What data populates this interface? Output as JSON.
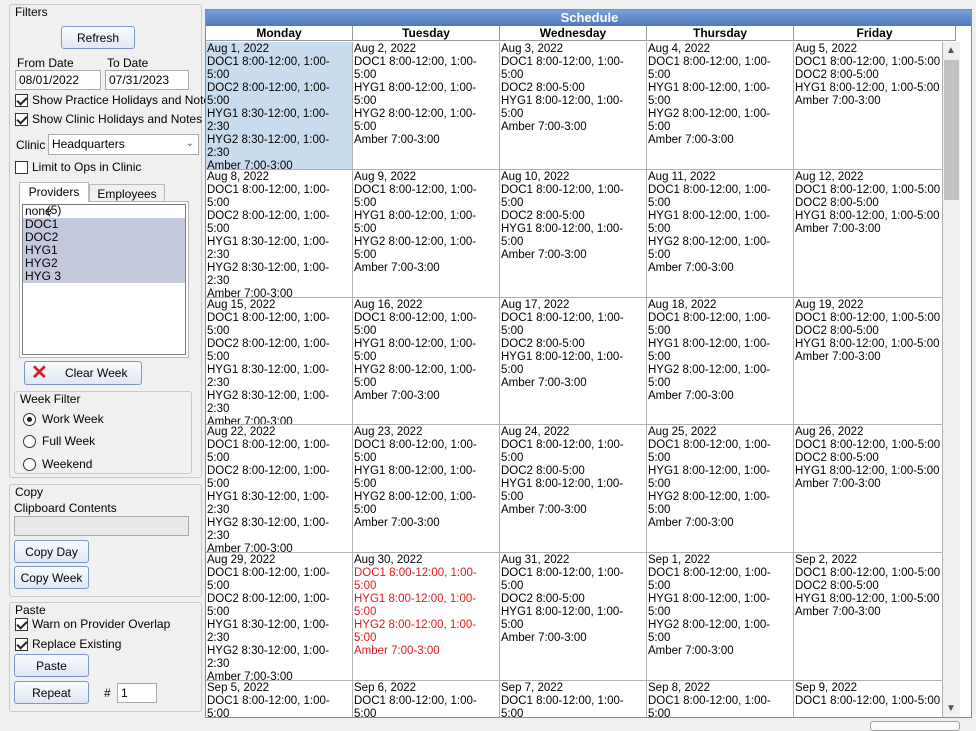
{
  "filters": {
    "title": "Filters",
    "refresh_label": "Refresh",
    "from_date_label": "From Date",
    "to_date_label": "To Date",
    "from_date": "08/01/2022",
    "to_date": "07/31/2023",
    "show_practice_holidays": "Show Practice Holidays and Notes",
    "show_clinic_holidays": "Show Clinic Holidays and Notes",
    "clinic_label": "Clinic",
    "clinic_value": "Headquarters",
    "limit_ops": "Limit to Ops in Clinic",
    "tabs": [
      "Providers (5)",
      "Employees (4)"
    ],
    "providers": [
      "none",
      "DOC1",
      "DOC2",
      "HYG1",
      "HYG2",
      "HYG 3"
    ],
    "clear_week_label": "Clear Week",
    "week_filter_title": "Week Filter",
    "week_options": [
      "Work Week",
      "Full Week",
      "Weekend"
    ]
  },
  "copy": {
    "title": "Copy",
    "clipboard_label": "Clipboard Contents",
    "clipboard_value": "",
    "copy_day": "Copy Day",
    "copy_week": "Copy Week"
  },
  "paste": {
    "title": "Paste",
    "warn_overlap": "Warn on Provider Overlap",
    "replace_existing": "Replace Existing",
    "paste_label": "Paste",
    "repeat_label": "Repeat",
    "hash": "#",
    "repeat_count": "1"
  },
  "schedule": {
    "title": "Schedule",
    "days": [
      "Monday",
      "Tuesday",
      "Wednesday",
      "Thursday",
      "Friday"
    ],
    "weeks": [
      [
        {
          "date": "Aug 1, 2022",
          "lines": [
            "DOC1 8:00-12:00, 1:00-5:00",
            "DOC2 8:00-12:00, 1:00-5:00",
            "HYG1 8:30-12:00, 1:00-2:30",
            "HYG2 8:30-12:00, 1:00-2:30",
            "Amber 7:00-3:00"
          ]
        },
        {
          "date": "Aug 2, 2022",
          "lines": [
            "DOC1 8:00-12:00, 1:00-5:00",
            "HYG1 8:00-12:00, 1:00-5:00",
            "HYG2 8:00-12:00, 1:00-5:00",
            "Amber 7:00-3:00"
          ]
        },
        {
          "date": "Aug 3, 2022",
          "lines": [
            "DOC1 8:00-12:00, 1:00-5:00",
            "DOC2 8:00-5:00",
            "HYG1 8:00-12:00, 1:00-5:00",
            "Amber 7:00-3:00"
          ]
        },
        {
          "date": "Aug 4, 2022",
          "lines": [
            "DOC1 8:00-12:00, 1:00-5:00",
            "HYG1 8:00-12:00, 1:00-5:00",
            "HYG2 8:00-12:00, 1:00-5:00",
            "Amber 7:00-3:00"
          ]
        },
        {
          "date": "Aug 5, 2022",
          "lines": [
            "DOC1 8:00-12:00, 1:00-5:00",
            "DOC2 8:00-5:00",
            "HYG1 8:00-12:00, 1:00-5:00",
            "Amber 7:00-3:00"
          ]
        }
      ],
      [
        {
          "date": "Aug 8, 2022",
          "lines": [
            "DOC1 8:00-12:00, 1:00-5:00",
            "DOC2 8:00-12:00, 1:00-5:00",
            "HYG1 8:30-12:00, 1:00-2:30",
            "HYG2 8:30-12:00, 1:00-2:30",
            "Amber 7:00-3:00"
          ]
        },
        {
          "date": "Aug 9, 2022",
          "lines": [
            "DOC1 8:00-12:00, 1:00-5:00",
            "HYG1 8:00-12:00, 1:00-5:00",
            "HYG2 8:00-12:00, 1:00-5:00",
            "Amber 7:00-3:00"
          ]
        },
        {
          "date": "Aug 10, 2022",
          "lines": [
            "DOC1 8:00-12:00, 1:00-5:00",
            "DOC2 8:00-5:00",
            "HYG1 8:00-12:00, 1:00-5:00",
            "Amber 7:00-3:00"
          ]
        },
        {
          "date": "Aug 11, 2022",
          "lines": [
            "DOC1 8:00-12:00, 1:00-5:00",
            "HYG1 8:00-12:00, 1:00-5:00",
            "HYG2 8:00-12:00, 1:00-5:00",
            "Amber 7:00-3:00"
          ]
        },
        {
          "date": "Aug 12, 2022",
          "lines": [
            "DOC1 8:00-12:00, 1:00-5:00",
            "DOC2 8:00-5:00",
            "HYG1 8:00-12:00, 1:00-5:00",
            "Amber 7:00-3:00"
          ]
        }
      ],
      [
        {
          "date": "Aug 15, 2022",
          "lines": [
            "DOC1 8:00-12:00, 1:00-5:00",
            "DOC2 8:00-12:00, 1:00-5:00",
            "HYG1 8:30-12:00, 1:00-2:30",
            "HYG2 8:30-12:00, 1:00-2:30",
            "Amber 7:00-3:00"
          ]
        },
        {
          "date": "Aug 16, 2022",
          "lines": [
            "DOC1 8:00-12:00, 1:00-5:00",
            "HYG1 8:00-12:00, 1:00-5:00",
            "HYG2 8:00-12:00, 1:00-5:00",
            "Amber 7:00-3:00"
          ]
        },
        {
          "date": "Aug 17, 2022",
          "lines": [
            "DOC1 8:00-12:00, 1:00-5:00",
            "DOC2 8:00-5:00",
            "HYG1 8:00-12:00, 1:00-5:00",
            "Amber 7:00-3:00"
          ]
        },
        {
          "date": "Aug 18, 2022",
          "lines": [
            "DOC1 8:00-12:00, 1:00-5:00",
            "HYG1 8:00-12:00, 1:00-5:00",
            "HYG2 8:00-12:00, 1:00-5:00",
            "Amber 7:00-3:00"
          ]
        },
        {
          "date": "Aug 19, 2022",
          "lines": [
            "DOC1 8:00-12:00, 1:00-5:00",
            "DOC2 8:00-5:00",
            "HYG1 8:00-12:00, 1:00-5:00",
            "Amber 7:00-3:00"
          ]
        }
      ],
      [
        {
          "date": "Aug 22, 2022",
          "lines": [
            "DOC1 8:00-12:00, 1:00-5:00",
            "DOC2 8:00-12:00, 1:00-5:00",
            "HYG1 8:30-12:00, 1:00-2:30",
            "HYG2 8:30-12:00, 1:00-2:30",
            "Amber 7:00-3:00"
          ]
        },
        {
          "date": "Aug 23, 2022",
          "lines": [
            "DOC1 8:00-12:00, 1:00-5:00",
            "HYG1 8:00-12:00, 1:00-5:00",
            "HYG2 8:00-12:00, 1:00-5:00",
            "Amber 7:00-3:00"
          ]
        },
        {
          "date": "Aug 24, 2022",
          "lines": [
            "DOC1 8:00-12:00, 1:00-5:00",
            "DOC2 8:00-5:00",
            "HYG1 8:00-12:00, 1:00-5:00",
            "Amber 7:00-3:00"
          ]
        },
        {
          "date": "Aug 25, 2022",
          "lines": [
            "DOC1 8:00-12:00, 1:00-5:00",
            "HYG1 8:00-12:00, 1:00-5:00",
            "HYG2 8:00-12:00, 1:00-5:00",
            "Amber 7:00-3:00"
          ]
        },
        {
          "date": "Aug 26, 2022",
          "lines": [
            "DOC1 8:00-12:00, 1:00-5:00",
            "DOC2 8:00-5:00",
            "HYG1 8:00-12:00, 1:00-5:00",
            "Amber 7:00-3:00"
          ]
        }
      ],
      [
        {
          "date": "Aug 29, 2022",
          "lines": [
            "DOC1 8:00-12:00, 1:00-5:00",
            "DOC2 8:00-12:00, 1:00-5:00",
            "HYG1 8:30-12:00, 1:00-2:30",
            "HYG2 8:30-12:00, 1:00-2:30",
            "Amber 7:00-3:00"
          ]
        },
        {
          "date": "Aug 30, 2022",
          "holiday": true,
          "lines": [
            "DOC1 8:00-12:00, 1:00-5:00",
            "HYG1 8:00-12:00, 1:00-5:00",
            "HYG2 8:00-12:00, 1:00-5:00",
            "Amber 7:00-3:00"
          ]
        },
        {
          "date": "Aug 31, 2022",
          "lines": [
            "DOC1 8:00-12:00, 1:00-5:00",
            "DOC2 8:00-5:00",
            "HYG1 8:00-12:00, 1:00-5:00",
            "Amber 7:00-3:00"
          ]
        },
        {
          "date": "Sep 1, 2022",
          "lines": [
            "DOC1 8:00-12:00, 1:00-5:00",
            "HYG1 8:00-12:00, 1:00-5:00",
            "HYG2 8:00-12:00, 1:00-5:00",
            "Amber 7:00-3:00"
          ]
        },
        {
          "date": "Sep 2, 2022",
          "lines": [
            "DOC1 8:00-12:00, 1:00-5:00",
            "DOC2 8:00-5:00",
            "HYG1 8:00-12:00, 1:00-5:00",
            "Amber 7:00-3:00"
          ]
        }
      ],
      [
        {
          "date": "Sep 5, 2022",
          "lines": [
            "DOC1 8:00-12:00, 1:00-5:00"
          ]
        },
        {
          "date": "Sep 6, 2022",
          "lines": [
            "DOC1 8:00-12:00, 1:00-5:00"
          ]
        },
        {
          "date": "Sep 7, 2022",
          "lines": [
            "DOC1 8:00-12:00, 1:00-5:00"
          ]
        },
        {
          "date": "Sep 8, 2022",
          "lines": [
            "DOC1 8:00-12:00, 1:00-5:00"
          ]
        },
        {
          "date": "Sep 9, 2022",
          "lines": [
            "DOC1 8:00-12:00, 1:00-5:00"
          ]
        }
      ]
    ]
  },
  "colors": {
    "header_blue": "#5b82c4",
    "selected_cell": "#c9dbee",
    "holiday_red": "#e01818",
    "clear_icon_red": "#d42020"
  },
  "icons": [
    "chevron-down-icon",
    "clear-x-icon",
    "scroll-up-icon",
    "scroll-down-icon"
  ]
}
